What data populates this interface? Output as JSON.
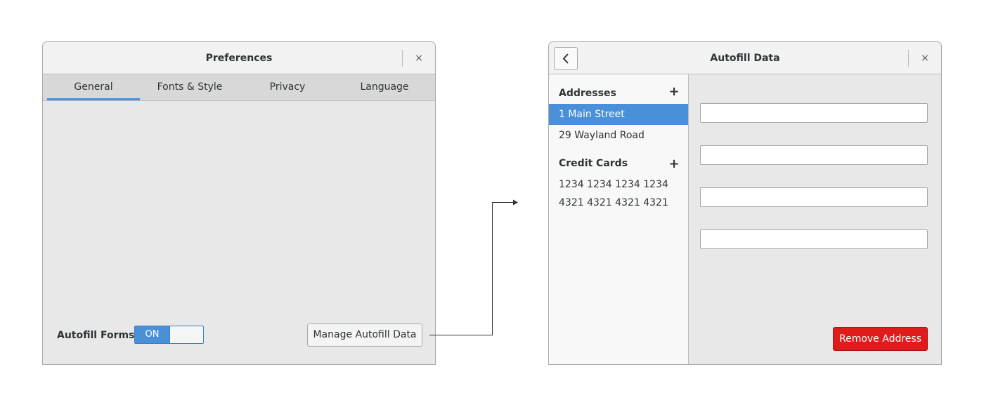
{
  "preferences_window": {
    "title": "Preferences",
    "close_glyph": "×",
    "tabs": [
      {
        "label": "General",
        "active": true
      },
      {
        "label": "Fonts & Style",
        "active": false
      },
      {
        "label": "Privacy",
        "active": false
      },
      {
        "label": "Language",
        "active": false
      }
    ],
    "autofill_label": "Autofill Forms",
    "autofill_switch": {
      "state_label": "ON",
      "on": true
    },
    "manage_button_label": "Manage Autofill Data"
  },
  "autofill_window": {
    "title": "Autofill Data",
    "close_glyph": "×",
    "back_icon": "chevron-left-icon",
    "addresses": {
      "heading": "Addresses",
      "add_glyph": "+",
      "items": [
        {
          "label": "1 Main Street",
          "selected": true
        },
        {
          "label": "29 Wayland Road",
          "selected": false
        }
      ]
    },
    "credit_cards": {
      "heading": "Credit Cards",
      "add_glyph": "+",
      "items": [
        {
          "label": "1234 1234 1234 1234"
        },
        {
          "label": "4321 4321 4321 4321"
        }
      ]
    },
    "fields": [
      {
        "value": ""
      },
      {
        "value": ""
      },
      {
        "value": ""
      },
      {
        "value": ""
      }
    ],
    "remove_button_label": "Remove Address"
  },
  "colors": {
    "accent": "#4a90d9",
    "danger": "#e01b1b",
    "window_bg": "#e8e8e8",
    "titlebar_bg": "#f2f2f2",
    "sidebar_bg": "#f8f8f8"
  }
}
